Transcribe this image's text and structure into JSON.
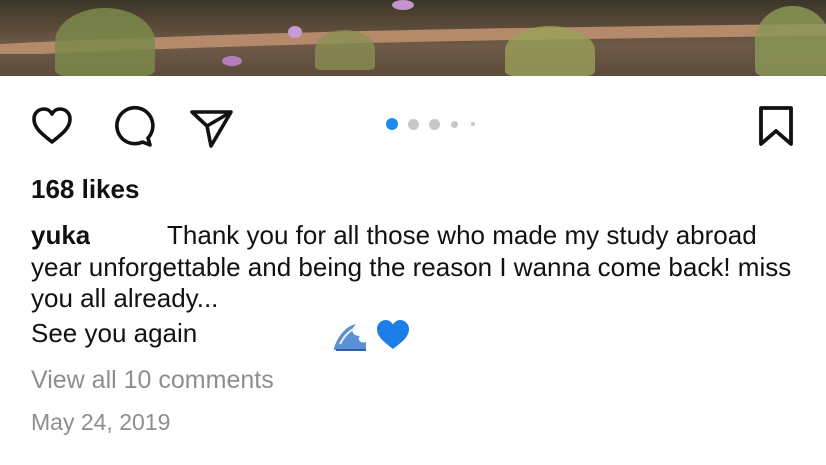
{
  "post": {
    "likes_text": "168 likes",
    "caption": {
      "username": "yuka",
      "text": "Thank you for all those who made my study abroad year unforgettable and being the reason I wanna come back! miss you all already...",
      "second_line": "See you again"
    },
    "comments_link": "View all 10 comments",
    "date": "May 24, 2019"
  },
  "actions": {
    "like_icon": "heart-icon",
    "comment_icon": "speech-bubble-icon",
    "share_icon": "paper-plane-icon",
    "save_icon": "bookmark-icon"
  },
  "carousel": {
    "total": 5,
    "active_index": 0,
    "active_color": "#1a8cf0",
    "inactive_color": "#c7c7c7"
  },
  "emojis": [
    "wave-emoji",
    "blue-heart-emoji"
  ]
}
